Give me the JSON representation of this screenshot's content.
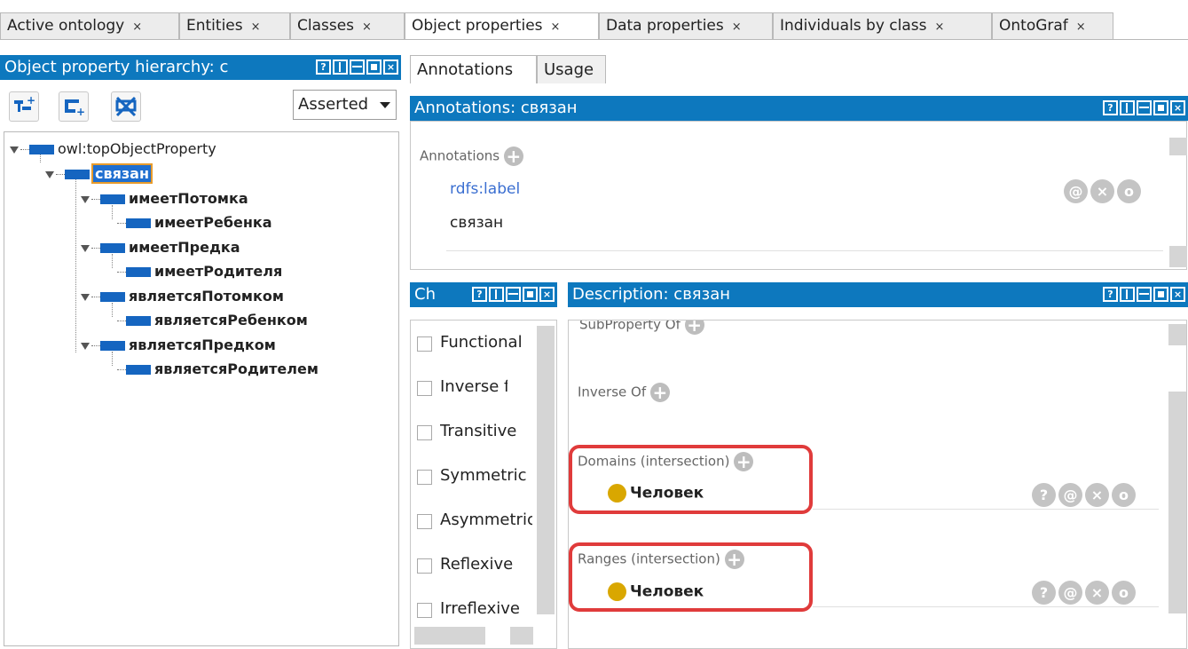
{
  "tabs": [
    {
      "label": "Active ontology",
      "close": "×"
    },
    {
      "label": "Entities",
      "close": "×"
    },
    {
      "label": "Classes",
      "close": "×"
    },
    {
      "label": "Object properties",
      "close": "×"
    },
    {
      "label": "Data properties",
      "close": "×"
    },
    {
      "label": "Individuals by class",
      "close": "×"
    },
    {
      "label": "OntoGraf",
      "close": "×"
    }
  ],
  "left_panel": {
    "title": "Object property hierarchy: с",
    "asserted_select": "Asserted",
    "tree": [
      {
        "label": "owl:topObjectProperty"
      },
      {
        "label": "связан"
      },
      {
        "label": "имеетПотомка"
      },
      {
        "label": "имеетРебенка"
      },
      {
        "label": "имеетПредка"
      },
      {
        "label": "имеетРодителя"
      },
      {
        "label": "являетсяПотомком"
      },
      {
        "label": "являетсяРебенком"
      },
      {
        "label": "являетсяПредком"
      },
      {
        "label": "являетсяРодителем"
      }
    ]
  },
  "subtabs": [
    "Annotations",
    "Usage"
  ],
  "annotations_panel": {
    "title": "Annotations: связан",
    "section_label": "Annotations",
    "property": "rdfs:label",
    "value": "связан"
  },
  "characteristics_panel": {
    "title": "Ch",
    "items": [
      "Functional",
      "Inverse func",
      "Transitive",
      "Symmetric",
      "Asymmetric",
      "Reflexive",
      "Irreflexive"
    ]
  },
  "description_panel": {
    "title": "Description: связан",
    "subproperty_label": "SubProperty Of",
    "inverse_label": "Inverse Of",
    "domains_label": "Domains (intersection)",
    "domains_value": "Человек",
    "ranges_label": "Ranges (intersection)",
    "ranges_value": "Человек"
  },
  "icons": {
    "help": "?",
    "annotate": "@",
    "delete": "×",
    "edit": "o",
    "add": "+"
  },
  "colors": {
    "header_blue": "#0d78be",
    "highlight_red": "#e03b3b",
    "class_dot": "#d9a700",
    "property_bar": "#1565c0"
  }
}
